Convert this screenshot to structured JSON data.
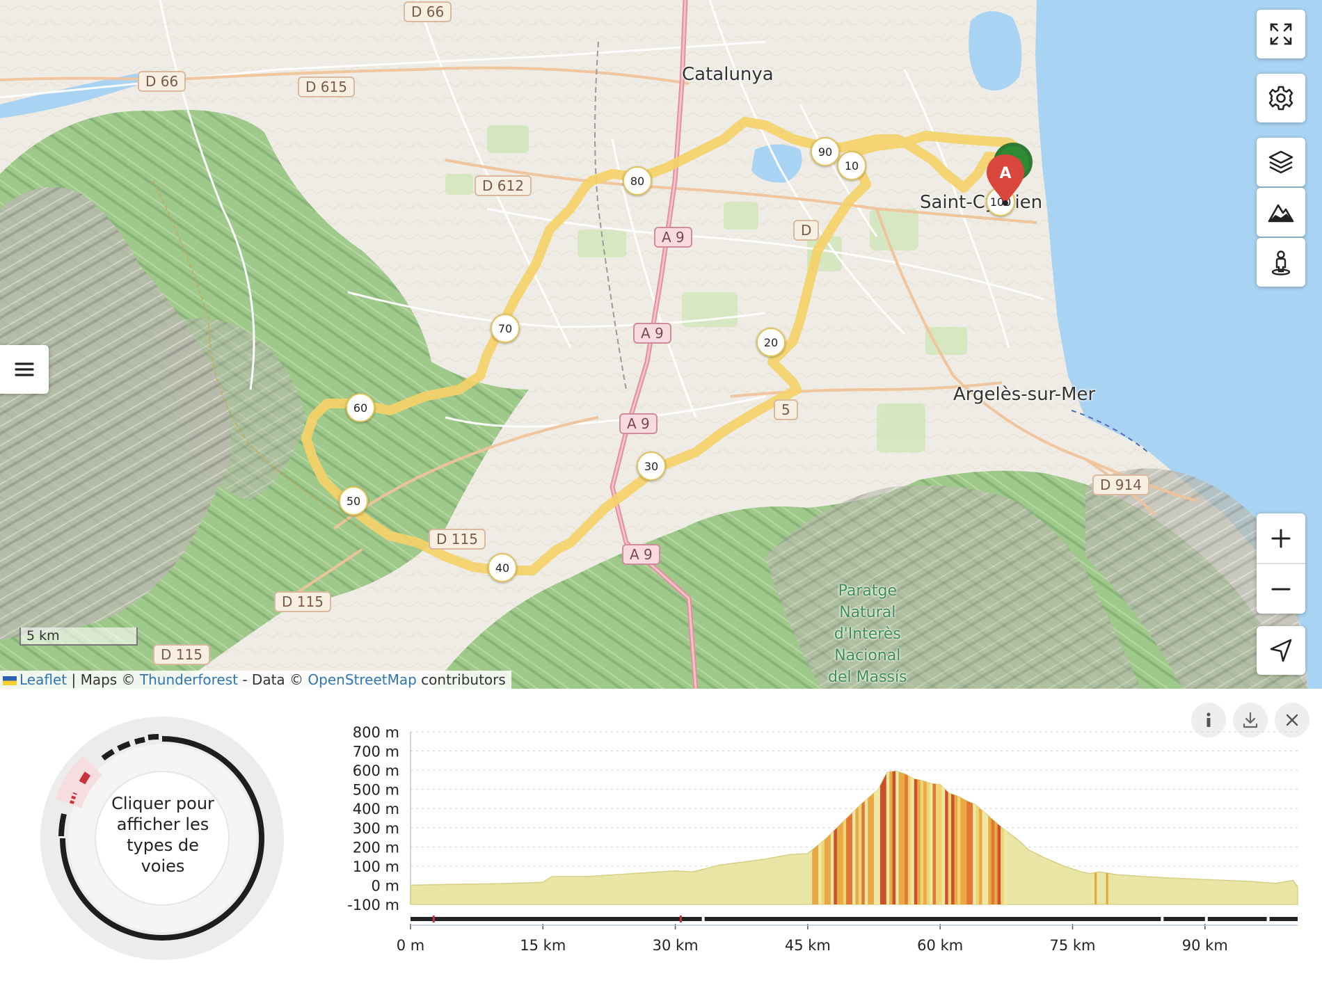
{
  "map": {
    "places": [
      {
        "id": "catalunya",
        "label": "Catalunya"
      },
      {
        "id": "saint-cyprien",
        "label": "Saint-Cyprien"
      },
      {
        "id": "argeles",
        "label": "Argelès-sur-Mer"
      }
    ],
    "park_label": [
      "Paratge",
      "Natural",
      "d'Interès",
      "Nacional",
      "del Massís"
    ],
    "road_shields": [
      "D 66",
      "D 66",
      "D 615",
      "D 612",
      "A 9",
      "A 9",
      "A 9",
      "A 9",
      "D 914",
      "D 115",
      "D 115",
      "D 115",
      "D",
      "5"
    ],
    "km_markers": [
      "10",
      "20",
      "30",
      "40",
      "50",
      "60",
      "70",
      "80",
      "90",
      "100"
    ],
    "start_marker": "A",
    "scale_label": "5 km",
    "attribution": {
      "leaflet": "Leaflet",
      "sep": " | Maps © ",
      "thunderforest": "Thunderforest",
      "data": " - Data © ",
      "osm": "OpenStreetMap",
      "contributors": " contributors"
    },
    "controls": {
      "right": [
        "fullscreen-icon",
        "settings-gear-icon",
        "layers-icon",
        "terrain-icon",
        "pegman-icon"
      ],
      "left": "menu-icon",
      "zoom": [
        "plus-icon",
        "minus-icon"
      ],
      "locate": "locate-arrow-icon"
    },
    "colors": {
      "route": "#f5d169",
      "start": "#d9463b",
      "end": "#2e7a33",
      "sea": "#a9d3f2"
    }
  },
  "panel": {
    "buttons": [
      "info-icon",
      "download-icon",
      "close-icon"
    ],
    "donut_center_text": [
      "Cliquer pour",
      "afficher les",
      "types de voies"
    ],
    "chart_data": {
      "type": "area",
      "y_ticks": [
        "800 m",
        "700 m",
        "600 m",
        "500 m",
        "400 m",
        "300 m",
        "200 m",
        "100 m",
        "0 m",
        "-100 m"
      ],
      "x_ticks": [
        "0 m",
        "15 km",
        "30 km",
        "45 km",
        "60 km",
        "75 km",
        "90 km"
      ],
      "ylim": [
        -100,
        800
      ],
      "xlim_km": [
        0,
        100.5
      ],
      "series": [
        {
          "distance_km": [
            0,
            5,
            10,
            15,
            16,
            20,
            25,
            30,
            32,
            35,
            40,
            43,
            45,
            47,
            49,
            51,
            53,
            54,
            55,
            56,
            57,
            58,
            59,
            60,
            61,
            62,
            63,
            64,
            65,
            66,
            67,
            69,
            70,
            72,
            74,
            76,
            77,
            78,
            80,
            85,
            90,
            95,
            98,
            100,
            100.5
          ],
          "elevation_m": [
            0,
            5,
            8,
            15,
            45,
            45,
            60,
            75,
            70,
            105,
            135,
            160,
            165,
            240,
            330,
            420,
            500,
            590,
            595,
            580,
            555,
            545,
            530,
            525,
            480,
            465,
            440,
            420,
            380,
            340,
            300,
            230,
            185,
            140,
            100,
            70,
            60,
            70,
            55,
            40,
            30,
            20,
            10,
            25,
            -10
          ]
        }
      ],
      "grade_colors": [
        "#ede9a4",
        "#f0d071",
        "#e9a23b",
        "#e06c2a",
        "#c8401f"
      ],
      "grid": true
    }
  }
}
